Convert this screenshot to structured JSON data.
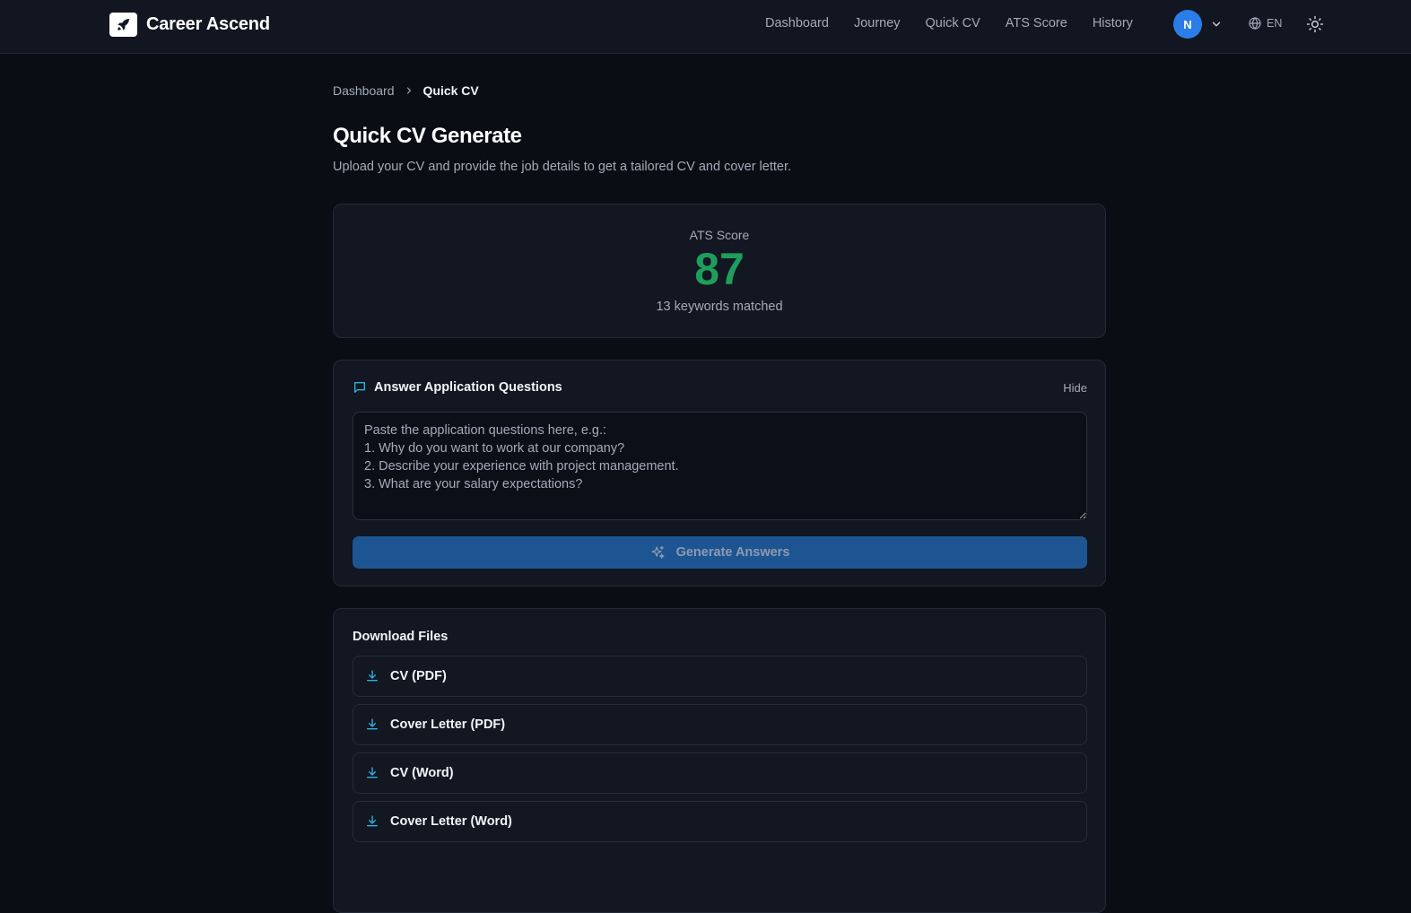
{
  "header": {
    "brand": "Career Ascend",
    "nav": [
      "Dashboard",
      "Journey",
      "Quick CV",
      "ATS Score",
      "History"
    ],
    "avatar_initial": "N",
    "language": "EN"
  },
  "breadcrumb": {
    "parent": "Dashboard",
    "current": "Quick CV"
  },
  "page": {
    "title": "Quick CV Generate",
    "subtitle": "Upload your CV and provide the job details to get a tailored CV and cover letter."
  },
  "ats": {
    "label": "ATS Score",
    "score": "87",
    "keywords": "13 keywords matched",
    "score_color": "#1f9d5c"
  },
  "questions": {
    "title": "Answer Application Questions",
    "hide_label": "Hide",
    "placeholder": "Paste the application questions here, e.g.:\n1. Why do you want to work at our company?\n2. Describe your experience with project management.\n3. What are your salary expectations?",
    "value": "",
    "generate_label": "Generate Answers"
  },
  "downloads": {
    "title": "Download Files",
    "items": [
      {
        "label": "CV (PDF)"
      },
      {
        "label": "Cover Letter (PDF)"
      },
      {
        "label": "CV (Word)"
      },
      {
        "label": "Cover Letter (Word)"
      }
    ]
  },
  "colors": {
    "background": "#0a0d14",
    "accent": "#2b7de9",
    "icon_accent": "#2fb3e0",
    "button": "#1d5592"
  }
}
